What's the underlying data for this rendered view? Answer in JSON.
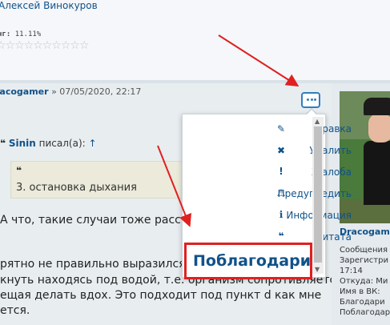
{
  "profile_top": {
    "author_name": "Алексей Винокуров",
    "rating_label": "нг:",
    "rating_value": "11.11%",
    "stars": "☆☆☆☆☆☆☆☆☆☆"
  },
  "post": {
    "author": "racogamer",
    "date": " » 07/05/2020, 22:17",
    "quote_mark": "❝",
    "quote_author": "Sinin",
    "quote_said": " писал(а): ",
    "quote_up": "↑",
    "quote_text": "3. остановка дыхания",
    "line1": "А что, такие случаи тоже рассмат",
    "line2": "рятно не правильно выразился.",
    "line3": "кнуть находясь под водой, т.е. организм сопротивляется",
    "line4": "ещая делать вдох. Это подходит под пункт d как мне",
    "line5": "ется."
  },
  "menu": {
    "items": [
      {
        "label": "Правка",
        "icon": "✎"
      },
      {
        "label": "Удалить",
        "icon": "✖"
      },
      {
        "label": "Жалоба",
        "icon": "!"
      },
      {
        "label": "Предупредить",
        "icon": "⚠"
      },
      {
        "label": "Информация",
        "icon": "ℹ"
      },
      {
        "label": "Цитата",
        "icon": "❝"
      }
    ],
    "thanks": "Поблагодарить"
  },
  "sidebar_profile": {
    "name": "Dracogamer",
    "lines": [
      "Сообщения",
      "Зарегистри",
      "17:14",
      "Откуда: Ми",
      "Имя в ВК: ",
      "Благодари",
      "Поблагодар"
    ]
  },
  "colors": {
    "link": "#105289",
    "highlight": "#e02020"
  }
}
